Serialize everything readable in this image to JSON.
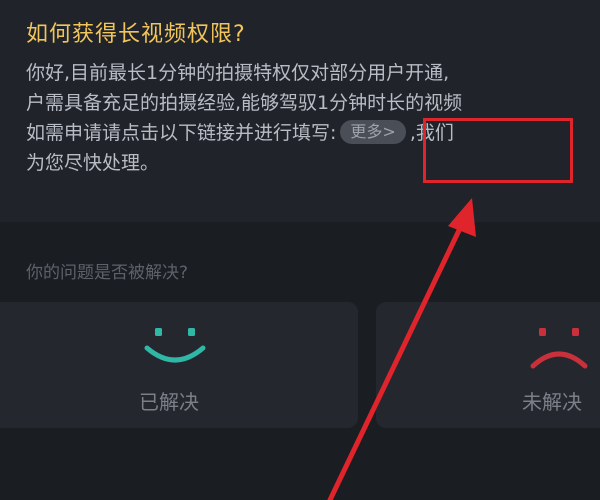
{
  "faq": {
    "title": "如何获得长视频权限?",
    "lines": {
      "l1": "你好,目前最长1分钟的拍摄特权仅对部分用户开通,",
      "l2": "户需具备充足的拍摄经验,能够驾驭1分钟时长的视频",
      "l3_before": "如需申请请点击以下链接并进行填写:",
      "l3_after": ",我们",
      "l4": "为您尽快处理。"
    },
    "more_link": "更多>"
  },
  "feedback": {
    "question": "你的问题是否被解决?",
    "resolved_label": "已解决",
    "unresolved_label": "未解决"
  },
  "colors": {
    "title": "#f1c55a",
    "smile": "#2fb8a6",
    "frown": "#c8303c",
    "annotation": "#e0242b"
  },
  "icons": {
    "resolved": "smile-face-icon",
    "unresolved": "sad-face-icon"
  }
}
